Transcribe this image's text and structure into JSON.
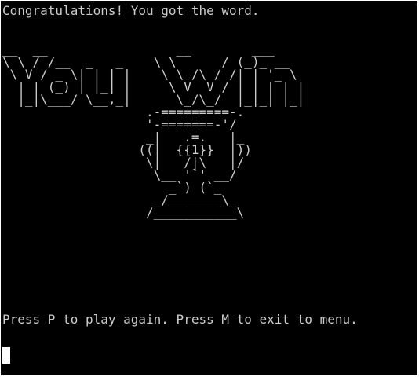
{
  "terminal": {
    "message_top": "Congratulations! You got the word.",
    "ascii_art": "__  __                 __        ___\n\\ \\ / /__  _   _    \\ \\      / (_)_ __\n \\ V / _ \\| | | |    \\ \\ /\\ / /| | '_ \\\n  | | (_) | |_| |     \\ V  V / | | | | |\n  |_|\\___/ \\__,_|      \\_/\\_/  |_|_| |_|\n                   .-=========-.\n                   '-=======-'/\n                   _|   .=.   |_\n                  ((|  {{1}}  |))\n                   \\|   /|\\   |/\n                    \\__ '`' __/\n                      _`) (`_\n                    _/_______\\_\n                   /___________\\",
    "message_bottom": "Press P to play again. Press M to exit to menu."
  }
}
